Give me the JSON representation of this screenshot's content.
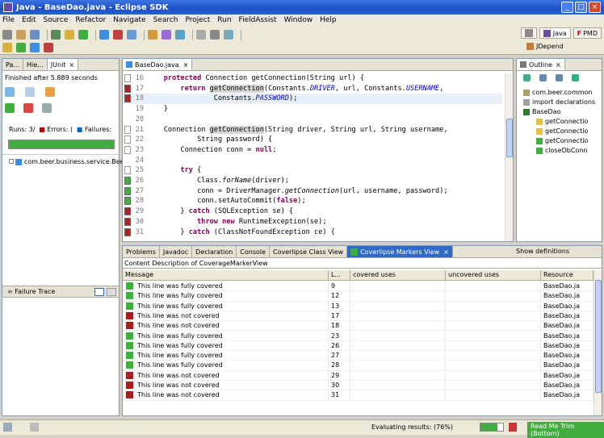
{
  "window": {
    "title": "Java - BaseDao.java - Eclipse SDK"
  },
  "menu": [
    "File",
    "Edit",
    "Source",
    "Refactor",
    "Navigate",
    "Search",
    "Project",
    "Run",
    "FieldAssist",
    "Window",
    "Help"
  ],
  "perspectives": {
    "java": "Java",
    "pmd": "PMD",
    "jdepend": "JDepend"
  },
  "left_panel": {
    "tabs": [
      "Pa...",
      "Hie...",
      "JUnit"
    ],
    "finished": "Finished after 5.889 seconds",
    "runs_label": "Runs:",
    "runs_value": "3/",
    "errors_label": "Errors:",
    "errors_value": "(",
    "failures_label": "Failures:",
    "test_item": "com.beer.business.service.Bee",
    "failure_trace": "Failure Trace",
    "progress_color": "#3fae3f"
  },
  "editor": {
    "tab": "BaseDao.java",
    "lines": [
      {
        "n": "16",
        "m": "e",
        "t": "    <span class=\"kw\">protected</span> Connection getConnection(String url) {"
      },
      {
        "n": "17",
        "m": "r",
        "t": "        <span class=\"kw\">return</span> <span class=\"hl\">getConnection</span>(Constants.<span class=\"const\">DRIVER</span>, url, Constants.<span class=\"const\">USERNAME</span>,"
      },
      {
        "n": "18",
        "m": "r",
        "t": "                Constants.<span class=\"const\">PASSWORD</span>);",
        "row": "hl18"
      },
      {
        "n": "19",
        "m": "",
        "t": "    }"
      },
      {
        "n": "20",
        "m": "",
        "t": ""
      },
      {
        "n": "21",
        "m": "e",
        "t": "    Connection <span class=\"hl\">getConnection</span>(String driver, String url, String username,"
      },
      {
        "n": "22",
        "m": "e",
        "t": "            String password) {"
      },
      {
        "n": "23",
        "m": "e",
        "t": "        Connection conn = <span class=\"kw\">null</span>;"
      },
      {
        "n": "24",
        "m": "",
        "t": ""
      },
      {
        "n": "25",
        "m": "e",
        "t": "        <span class=\"kw\">try</span> {"
      },
      {
        "n": "26",
        "m": "g",
        "t": "            Class.<span class=\"italic\">forName</span>(driver);"
      },
      {
        "n": "27",
        "m": "g",
        "t": "            conn = DriverManager.<span class=\"italic\">getConnection</span>(url, username, password);"
      },
      {
        "n": "28",
        "m": "g",
        "t": "            conn.setAutoCommit(<span class=\"kw\">false</span>);"
      },
      {
        "n": "29",
        "m": "r",
        "t": "        } <span class=\"kw\">catch</span> (SQLException se) {"
      },
      {
        "n": "30",
        "m": "r",
        "t": "            <span class=\"kw\">throw new</span> RuntimeException(se);"
      },
      {
        "n": "31",
        "m": "r",
        "t": "        } <span class=\"kw\">catch</span> (ClassNotFoundException ce) {"
      }
    ]
  },
  "outline": {
    "tab": "Outline",
    "items": [
      {
        "label": "com.beer.common",
        "indent": 1,
        "color": "#b0a070"
      },
      {
        "label": "import declarations",
        "indent": 1,
        "color": "#a0a0a0"
      },
      {
        "label": "BaseDao",
        "indent": 1,
        "color": "#2f7a2f"
      },
      {
        "label": "getConnectio",
        "indent": 3,
        "color": "#e8c040"
      },
      {
        "label": "getConnectio",
        "indent": 3,
        "color": "#e8c040"
      },
      {
        "label": "getConnectio",
        "indent": 3,
        "color": "#3fae3f"
      },
      {
        "label": "closeDbConn",
        "indent": 3,
        "color": "#3fae3f"
      }
    ]
  },
  "bottom": {
    "tabs": [
      "Problems",
      "Javadoc",
      "Declaration",
      "Console",
      "Coverlipse Class View",
      "Coverlipse Markers View"
    ],
    "show_definitions": "Show definitions",
    "content_desc": "Content Description of CoverageMarkerView",
    "columns": [
      "Message",
      "L...",
      "covered uses",
      "uncovered uses",
      "Resource"
    ],
    "rows": [
      {
        "ok": true,
        "msg": "This line was fully covered",
        "line": "9",
        "res": "BaseDao.ja"
      },
      {
        "ok": true,
        "msg": "This line was fully covered",
        "line": "12",
        "res": "BaseDao.ja"
      },
      {
        "ok": true,
        "msg": "This line was fully covered",
        "line": "13",
        "res": "BaseDao.ja"
      },
      {
        "ok": false,
        "msg": "This line was not covered",
        "line": "17",
        "res": "BaseDao.ja"
      },
      {
        "ok": false,
        "msg": "This line was not covered",
        "line": "18",
        "res": "BaseDao.ja"
      },
      {
        "ok": true,
        "msg": "This line was fully covered",
        "line": "23",
        "res": "BaseDao.ja"
      },
      {
        "ok": true,
        "msg": "This line was fully covered",
        "line": "26",
        "res": "BaseDao.ja"
      },
      {
        "ok": true,
        "msg": "This line was fully covered",
        "line": "27",
        "res": "BaseDao.ja"
      },
      {
        "ok": true,
        "msg": "This line was fully covered",
        "line": "28",
        "res": "BaseDao.ja"
      },
      {
        "ok": false,
        "msg": "This line was not covered",
        "line": "29",
        "res": "BaseDao.ja"
      },
      {
        "ok": false,
        "msg": "This line was not covered",
        "line": "30",
        "res": "BaseDao.ja"
      },
      {
        "ok": false,
        "msg": "This line was not covered",
        "line": "31",
        "res": "BaseDao.ja"
      }
    ]
  },
  "status": {
    "evaluating": "Evaluating results: (76%)",
    "readme": "Read Me Trim (Bottom)",
    "progress_pct": 76
  }
}
